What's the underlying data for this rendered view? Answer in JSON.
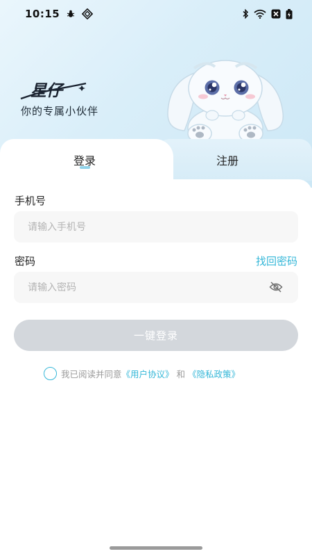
{
  "status_bar": {
    "time": "10:15",
    "icons": [
      "bug-icon",
      "shield-icon",
      "bluetooth-icon",
      "wifi-icon",
      "signal-off-icon",
      "battery-icon"
    ]
  },
  "brand": {
    "logo_text": "星仔",
    "slogan": "你的专属小伙伴",
    "mascot": "bunny-mascot"
  },
  "tabs": {
    "login": "登录",
    "register": "注册",
    "active": "login"
  },
  "form": {
    "phone_label": "手机号",
    "phone_placeholder": "请输入手机号",
    "phone_value": "",
    "password_label": "密码",
    "forgot_label": "找回密码",
    "password_placeholder": "请输入密码",
    "password_value": "",
    "password_toggle_icon": "eye-off-icon",
    "submit_label": "一键登录"
  },
  "agreement": {
    "prefix": "我已阅读并同意",
    "user_agreement": "《用户协议》",
    "and": "和",
    "privacy_policy": "《隐私政策》",
    "checked": false
  },
  "colors": {
    "accent": "#35b7d8",
    "button_disabled": "#d3d7dc",
    "hero_bg": "#d9eef9"
  }
}
